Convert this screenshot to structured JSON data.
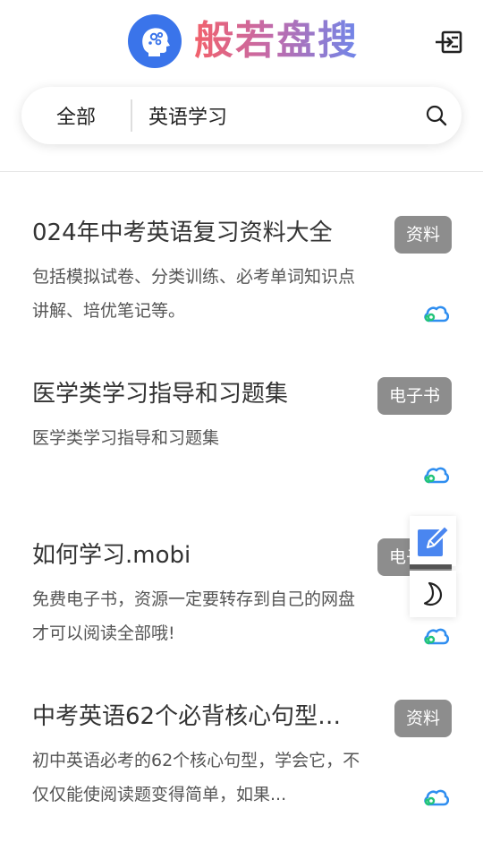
{
  "header": {
    "app_title": "般若盘搜",
    "logo_icon": "head-brain-icon",
    "login_icon": "login-icon",
    "brand_color": "#3a74ea"
  },
  "search": {
    "category": "全部",
    "query": "英语学习",
    "icon": "search-icon"
  },
  "results": [
    {
      "title": "024年中考英语复习资料大全",
      "tag": "资料",
      "desc": "包括模拟试卷、分类训练、必考单词知识点讲解、培优笔记等。",
      "icon": "cloud-icon"
    },
    {
      "title": "医学类学习指导和习题集",
      "tag": "电子书",
      "desc": "医学类学习指导和习题集",
      "icon": "cloud-icon"
    },
    {
      "title": "如何学习.mobi",
      "tag": "电子书",
      "desc": "免费电子书，资源一定要转存到自己的网盘才可以阅读全部哦!",
      "icon": "cloud-icon"
    },
    {
      "title": "中考英语62个必背核心句型+...",
      "tag": "资料",
      "desc": "初中英语必考的62个核心句型，学会它，不仅仅能使阅读题变得简单，如果...",
      "icon": "cloud-icon"
    }
  ],
  "floating": {
    "edit_icon": "edit-icon",
    "moon_icon": "moon-icon"
  },
  "colors": {
    "tag_bg": "#8d8d8d",
    "title_gradient_start": "#f2616b",
    "title_gradient_end": "#6f86ea",
    "cloud_blue": "#2f8ef0",
    "cloud_green": "#22c47a"
  }
}
